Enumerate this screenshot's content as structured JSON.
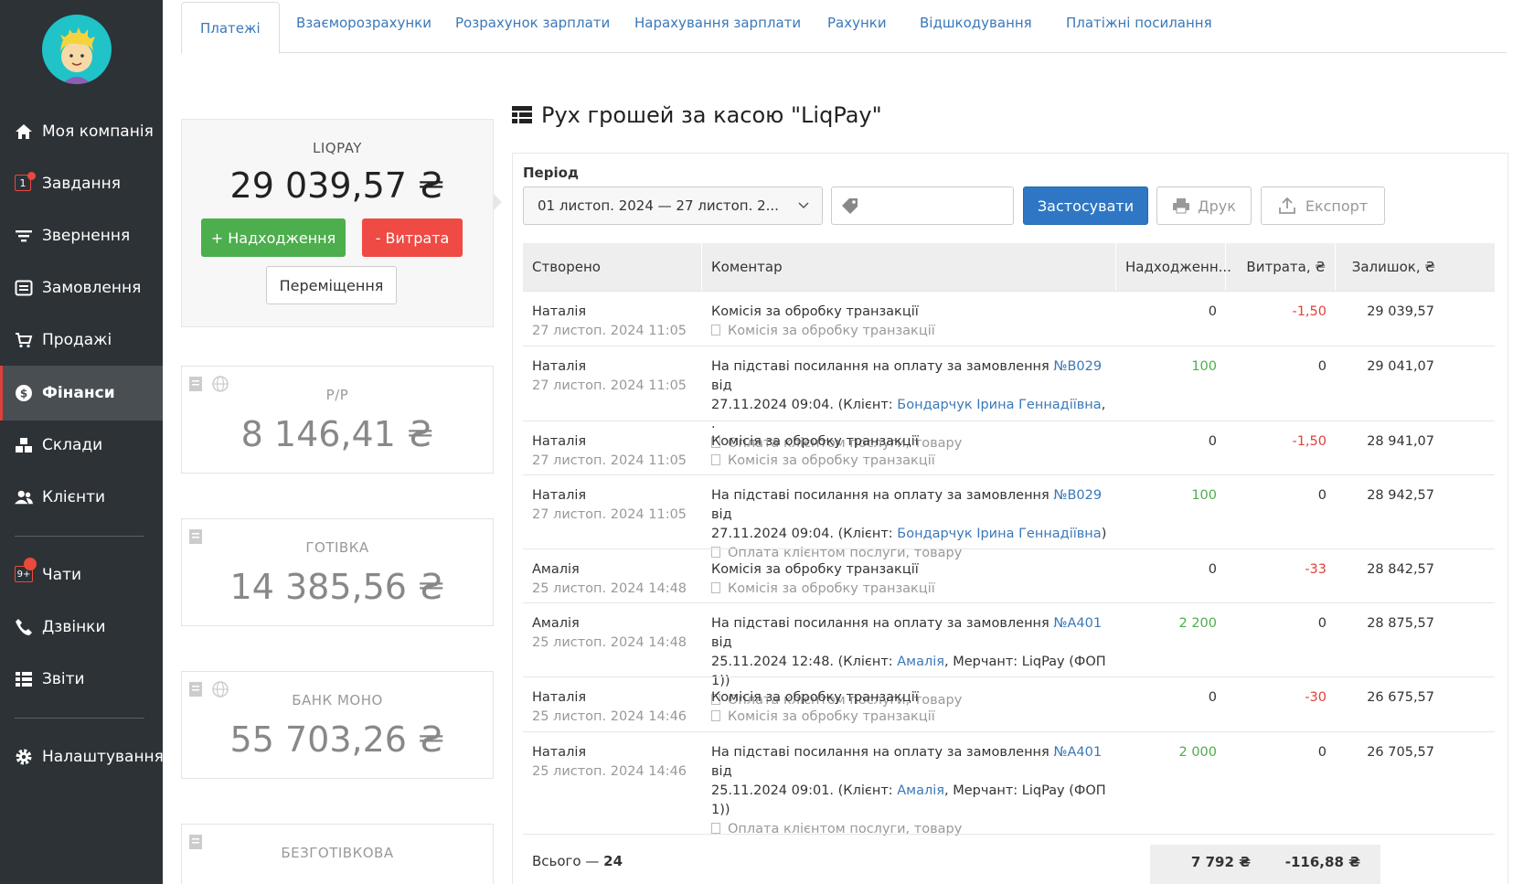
{
  "sidebar": {
    "items": [
      {
        "label": "Моя компанія",
        "icon": "home-icon"
      },
      {
        "label": "Завдання",
        "icon": "tasks-icon",
        "badge": "1"
      },
      {
        "label": "Звернення",
        "icon": "filter-icon"
      },
      {
        "label": "Замовлення",
        "icon": "orders-icon"
      },
      {
        "label": "Продажі",
        "icon": "cart-icon"
      },
      {
        "label": "Фінанси",
        "icon": "finance-icon"
      },
      {
        "label": "Склади",
        "icon": "warehouse-icon"
      },
      {
        "label": "Клієнти",
        "icon": "clients-icon"
      },
      {
        "label": "Чати",
        "icon": "chat-icon",
        "badge": "9+"
      },
      {
        "label": "Дзвінки",
        "icon": "phone-icon"
      },
      {
        "label": "Звіти",
        "icon": "reports-icon"
      },
      {
        "label": "Налаштування",
        "icon": "gear-icon"
      }
    ]
  },
  "tabs": [
    "Платежі",
    "Взаєморозрахунки",
    "Розрахунок зарплати",
    "Нарахування зарплати",
    "Рахунки",
    "Відшкодування",
    "Платіжні посилання"
  ],
  "cashbox_main": {
    "title": "LIQPAY",
    "amount": "29 039,57 ₴",
    "income_label": "+ Надходження",
    "expense_label": "- Витрата",
    "transfer_label": "Переміщення"
  },
  "cashboxes": [
    {
      "title": "Р/Р",
      "amount": "8 146,41 ₴"
    },
    {
      "title": "ГОТІВКА",
      "amount": "14 385,56 ₴"
    },
    {
      "title": "БАНК МОНО",
      "amount": "55 703,26 ₴"
    },
    {
      "title": "БЕЗГОТІВКОВА",
      "amount": ""
    }
  ],
  "header": {
    "title": "Рух грошей за касою \"LiqPay\""
  },
  "filters": {
    "period_label": "Період",
    "period_value": "01 листоп. 2024 — 27 листоп. 2...",
    "apply_label": "Застосувати",
    "print_label": "Друк",
    "export_label": "Експорт"
  },
  "table": {
    "columns": [
      "Створено",
      "Коментар",
      "Надходженн...",
      "Витрата, ₴",
      "Залишок, ₴"
    ],
    "rows": [
      {
        "author": "Наталія",
        "date": "27 листоп. 2024 11:05",
        "c1": "Комісія за обробку транзакції",
        "c2": "",
        "note": "Комісія за обробку транзакції",
        "income": "0",
        "expense": "-1,50",
        "balance": "29 039,57"
      },
      {
        "author": "Наталія",
        "date": "27 листоп. 2024 11:05",
        "c1": "На підставі посилання на оплату за замовлення ",
        "order": "№B029",
        "c1b": " від",
        "c2": "27.11.2024 09:04.  (Клієнт: ",
        "client": "Бондарчук Ірина Геннадіївна",
        "c2b": ",          .",
        "note": "Оплата клієнтом послуги, товару",
        "income": "100",
        "expense": "0",
        "balance": "29 041,07"
      },
      {
        "author": "Наталія",
        "date": "27 листоп. 2024 11:05",
        "c1": "Комісія за обробку транзакції",
        "c2": "",
        "note": "Комісія за обробку транзакції",
        "income": "0",
        "expense": "-1,50",
        "balance": "28 941,07"
      },
      {
        "author": "Наталія",
        "date": "27 листоп. 2024 11:05",
        "c1": "На підставі посилання на оплату за замовлення ",
        "order": "№B029",
        "c1b": " від",
        "c2": "27.11.2024 09:04.  (Клієнт: ",
        "client": "Бондарчук Ірина Геннадіївна",
        "c2b": ")",
        "note": "Оплата клієнтом послуги, товару",
        "income": "100",
        "expense": "0",
        "balance": "28 942,57"
      },
      {
        "author": "Амалія",
        "date": "25 листоп. 2024 14:48",
        "c1": "Комісія за обробку транзакції",
        "c2": "",
        "note": "Комісія за обробку транзакції",
        "income": "0",
        "expense": "-33",
        "balance": "28 842,57"
      },
      {
        "author": "Амалія",
        "date": "25 листоп. 2024 14:48",
        "c1": "На підставі посилання на оплату за замовлення ",
        "order": "№A401",
        "c1b": " від",
        "c2": "25.11.2024 12:48.  (Клієнт: ",
        "client": "Амалія",
        "c2b": ", Мерчант: LiqPay (ФОП 1))",
        "note": "Оплата клієнтом послуги, товару",
        "income": "2 200",
        "expense": "0",
        "balance": "28 875,57"
      },
      {
        "author": "Наталія",
        "date": "25 листоп. 2024 14:46",
        "c1": "Комісія за обробку транзакції",
        "c2": "",
        "note": "Комісія за обробку транзакції",
        "income": "0",
        "expense": "-30",
        "balance": "26 675,57"
      },
      {
        "author": "Наталія",
        "date": "25 листоп. 2024 14:46",
        "c1": "На підставі посилання на оплату за замовлення ",
        "order": "№A401",
        "c1b": " від",
        "c2": "25.11.2024 09:01.  (Клієнт: ",
        "client": "Амалія",
        "c2b": ", Мерчант: LiqPay (ФОП 1))",
        "note": "Оплата клієнтом послуги, товару",
        "income": "2 000",
        "expense": "0",
        "balance": "26 705,57"
      }
    ],
    "footer": {
      "total_label": "Всього — ",
      "total_count": "24",
      "income_total": "7 792 ₴",
      "expense_total": "-116,88 ₴"
    }
  },
  "colors": {
    "sidebar_bg": "#2d3236",
    "accent_blue": "#2f77c4",
    "income_green": "#4cae4c",
    "expense_red": "#e0403a"
  }
}
